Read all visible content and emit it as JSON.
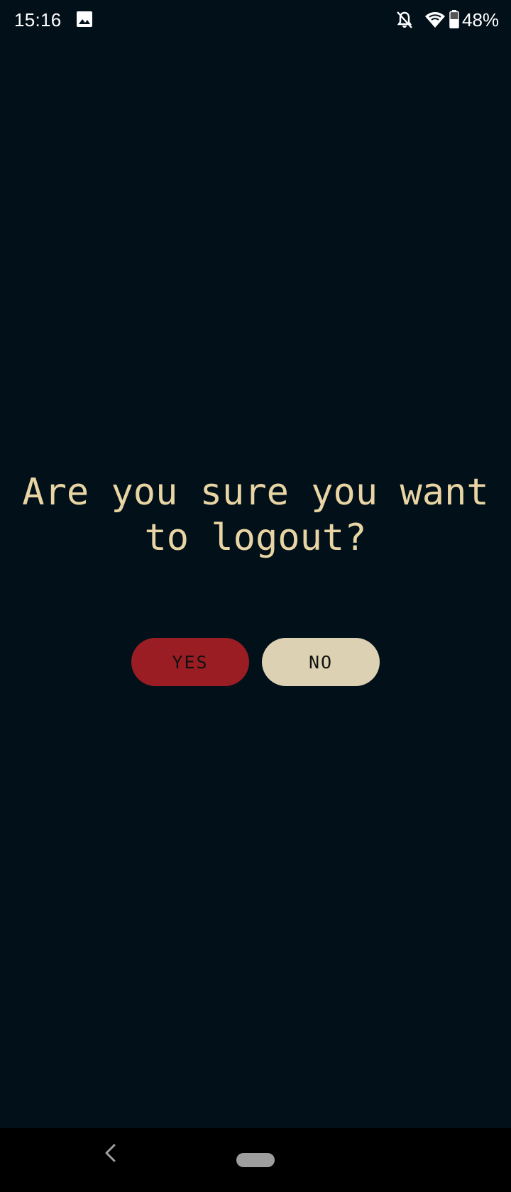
{
  "status_bar": {
    "time": "15:16",
    "battery": "48%",
    "icons": [
      "image-icon",
      "notifications-off-icon",
      "wifi-icon",
      "battery-icon"
    ]
  },
  "dialog": {
    "title": "Are you sure you want to logout?",
    "yes_label": "YES",
    "no_label": "NO"
  },
  "nav_bar": {
    "icons": [
      "back-icon",
      "home-pill"
    ]
  },
  "colors": {
    "background": "#02101a",
    "title": "#e8d5a3",
    "yes_button": "#9b1d24",
    "no_button": "#dcd1b2",
    "button_text": "#111111",
    "nav_background": "#000000"
  }
}
